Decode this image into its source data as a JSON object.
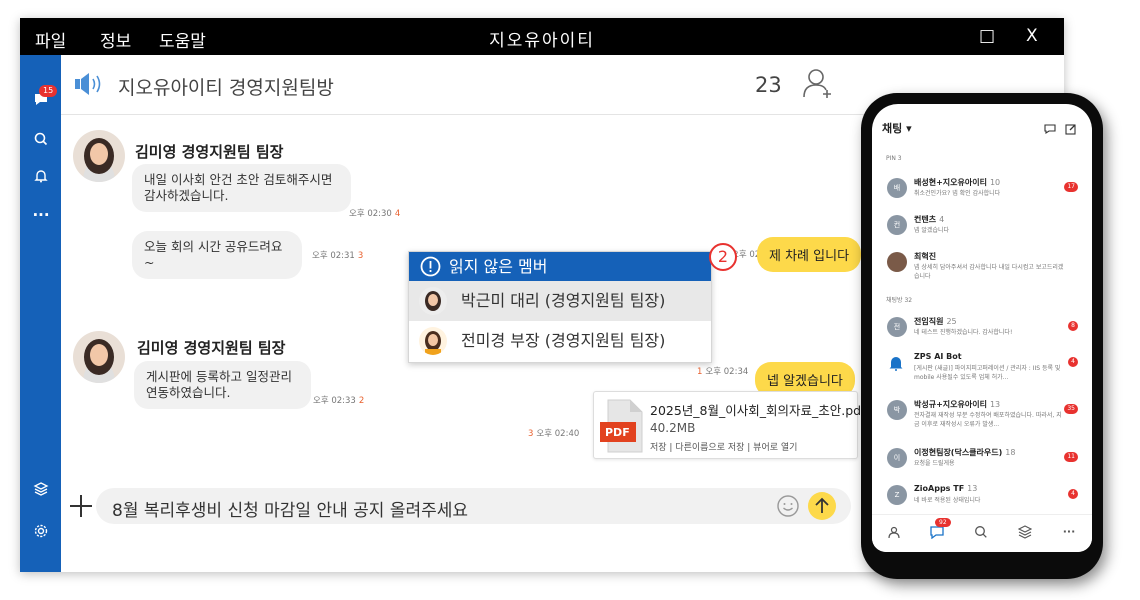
{
  "menu": {
    "file": "파일",
    "info": "정보",
    "help": "도움말"
  },
  "window": {
    "title": "지오유아이티",
    "maximize": "□",
    "close": "X"
  },
  "sidebar": {
    "chat_badge": "15"
  },
  "room": {
    "title": "지오유아이티 경영지원팀방",
    "member_count": "23"
  },
  "messages": {
    "sender1": "김미영 경영지원팀 팀장",
    "m1_line1": "내일 이사회 안건 초안 검토해주시면",
    "m1_line2": "감사하겠습니다.",
    "m1_time": "오후 02:30",
    "m1_unread": "4",
    "m2_text": "오늘 회의 시간 공유드려요~",
    "m2_time": "오후 02:31",
    "m2_unread": "3",
    "mine1_text": "제 차례 입니다",
    "mine1_time": "오후 02:33",
    "sender2": "김미영 경영지원팀 팀장",
    "m3_line1": "게시판에 등록하고 일정관리",
    "m3_line2": "연동하였습니다.",
    "m3_time": "오후 02:33",
    "m3_unread": "2",
    "mine2_text": "넵 알겠습니다",
    "mine2_time": "오후 02:34",
    "mine2_unread": "1",
    "file_name": "2025년_8월_이사회_회의자료_초안.pdf",
    "file_size": "40.2MB",
    "file_actions": "저장  |  다른이름으로 저장  |  뷰어로 열기",
    "file_icon_label": "PDF",
    "file_time": "오후 02:40",
    "file_unread": "3"
  },
  "unread_popup": {
    "title": "읽지 않은 멤버",
    "count": "2",
    "members": [
      "박근미 대리 (경영지원팀 팀장)",
      "전미경 부장 (경영지원팀 팀장)"
    ]
  },
  "composer": {
    "text": "8월 복리후생비 신청 마감일 안내 공지 올려주세요"
  },
  "phone": {
    "title": "채팅 ▾",
    "pin_label": "PIN 3",
    "group_label": "채팅방 32",
    "nav_badge": "92",
    "items": [
      {
        "avatar": "배",
        "name": "배성현+지오유아이티",
        "count": "10",
        "preview": "취소건인가요? 넵 확인 감사합니다",
        "badge": "17"
      },
      {
        "avatar": "컨",
        "name": "컨텐츠",
        "count": "4",
        "preview": "넵 알겠습니다",
        "badge": ""
      },
      {
        "avatar": "",
        "name": "최혁진",
        "count": "",
        "preview": "넵 상세히 답아주셔서 감사합니다 내일 다시컴고 보고드리겠습니다",
        "badge": ""
      },
      {
        "avatar": "전",
        "name": "전임직원",
        "count": "25",
        "preview": "네 테스트 진행하겠습니다. 감사합니다!",
        "badge": "8"
      },
      {
        "avatar": "",
        "name": "ZPS AI Bot",
        "count": "",
        "preview": "[게시판 (새글)] 파이지피고퍼레이션 / 관리자 : IIS 등록 및 mobile 사용될수 있도록 업체 허가...",
        "badge": "4"
      },
      {
        "avatar": "박",
        "name": "박성규+지오유아이티",
        "count": "13",
        "preview": "전자결재 재작성 부분 수정하여 배포하였습니다. 따라서, 지금 이후로 재작성시 오류가 발생...",
        "badge": "35"
      },
      {
        "avatar": "이",
        "name": "이정현팀장(닥스클라우드)",
        "count": "18",
        "preview": "요청을 드릴게용",
        "badge": "11"
      },
      {
        "avatar": "Z",
        "name": "ZioApps TF",
        "count": "13",
        "preview": "네 바로 적용된 상태입니다",
        "badge": "4"
      }
    ]
  }
}
